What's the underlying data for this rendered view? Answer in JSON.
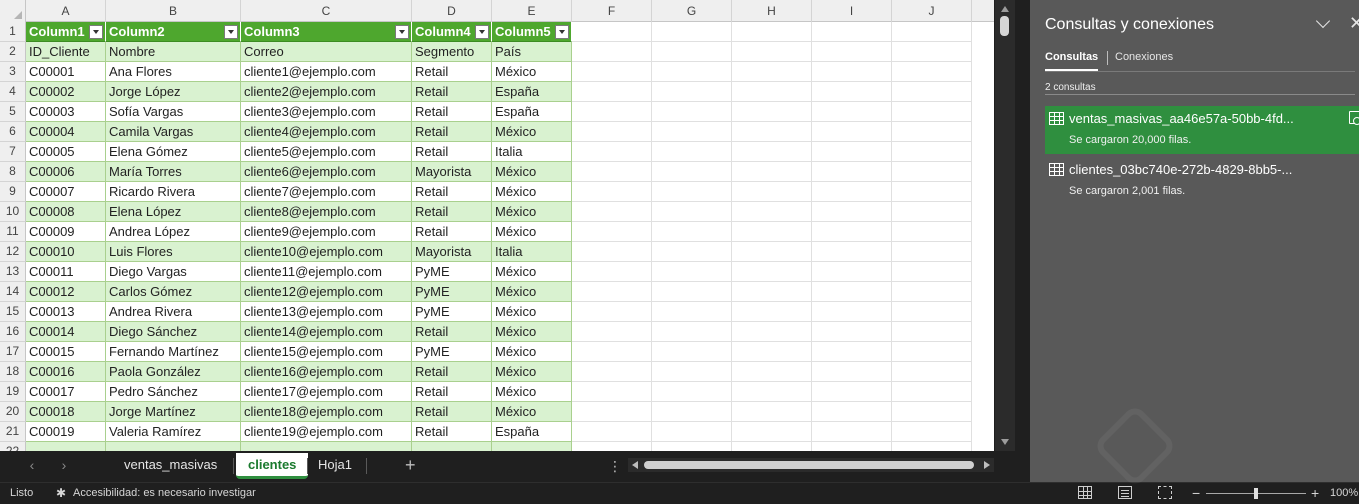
{
  "sheet": {
    "columns": [
      "A",
      "B",
      "C",
      "D",
      "E",
      "F",
      "G",
      "H",
      "I",
      "J"
    ],
    "table_headers": [
      "Column1",
      "Column2",
      "Column3",
      "Column4",
      "Column5"
    ],
    "rows": [
      [
        "ID_Cliente",
        "Nombre",
        "Correo",
        "Segmento",
        "País"
      ],
      [
        "C00001",
        "Ana Flores",
        "cliente1@ejemplo.com",
        "Retail",
        "México"
      ],
      [
        "C00002",
        "Jorge López",
        "cliente2@ejemplo.com",
        "Retail",
        "España"
      ],
      [
        "C00003",
        "Sofía Vargas",
        "cliente3@ejemplo.com",
        "Retail",
        "España"
      ],
      [
        "C00004",
        "Camila Vargas",
        "cliente4@ejemplo.com",
        "Retail",
        "México"
      ],
      [
        "C00005",
        "Elena Gómez",
        "cliente5@ejemplo.com",
        "Retail",
        "Italia"
      ],
      [
        "C00006",
        "María Torres",
        "cliente6@ejemplo.com",
        "Mayorista",
        "México"
      ],
      [
        "C00007",
        "Ricardo Rivera",
        "cliente7@ejemplo.com",
        "Retail",
        "México"
      ],
      [
        "C00008",
        "Elena López",
        "cliente8@ejemplo.com",
        "Retail",
        "México"
      ],
      [
        "C00009",
        "Andrea López",
        "cliente9@ejemplo.com",
        "Retail",
        "México"
      ],
      [
        "C00010",
        "Luis Flores",
        "cliente10@ejemplo.com",
        "Mayorista",
        "Italia"
      ],
      [
        "C00011",
        "Diego Vargas",
        "cliente11@ejemplo.com",
        "PyME",
        "México"
      ],
      [
        "C00012",
        "Carlos Gómez",
        "cliente12@ejemplo.com",
        "PyME",
        "México"
      ],
      [
        "C00013",
        "Andrea Rivera",
        "cliente13@ejemplo.com",
        "PyME",
        "México"
      ],
      [
        "C00014",
        "Diego Sánchez",
        "cliente14@ejemplo.com",
        "Retail",
        "México"
      ],
      [
        "C00015",
        "Fernando Martínez",
        "cliente15@ejemplo.com",
        "PyME",
        "México"
      ],
      [
        "C00016",
        "Paola González",
        "cliente16@ejemplo.com",
        "Retail",
        "México"
      ],
      [
        "C00017",
        "Pedro Sánchez",
        "cliente17@ejemplo.com",
        "Retail",
        "México"
      ],
      [
        "C00018",
        "Jorge Martínez",
        "cliente18@ejemplo.com",
        "Retail",
        "México"
      ],
      [
        "C00019",
        "Valeria Ramírez",
        "cliente19@ejemplo.com",
        "Retail",
        "España"
      ]
    ]
  },
  "tabs": {
    "sheets": [
      "ventas_masivas",
      "clientes",
      "Hoja1"
    ],
    "active": "clientes",
    "add_label": "+",
    "more_label": "⋮"
  },
  "status": {
    "ready": "Listo",
    "accessibility": "Accesibilidad: es necesario investigar",
    "zoom": "100%"
  },
  "pane": {
    "title": "Consultas y conexiones",
    "tab_queries": "Consultas",
    "tab_connections": "Conexiones",
    "count": "2 consultas",
    "queries": [
      {
        "name": "ventas_masivas_aa46e57a-50bb-4fd...",
        "status": "Se cargaron 20,000 filas."
      },
      {
        "name": "clientes_03bc740e-272b-4829-8bb5-...",
        "status": "Se cargaron 2,001 filas."
      }
    ]
  },
  "colors": {
    "table_header": "#4ea72e",
    "band_green": "#d9f2d0",
    "selected_query": "#2f8f3f",
    "pane_bg": "#595959"
  }
}
